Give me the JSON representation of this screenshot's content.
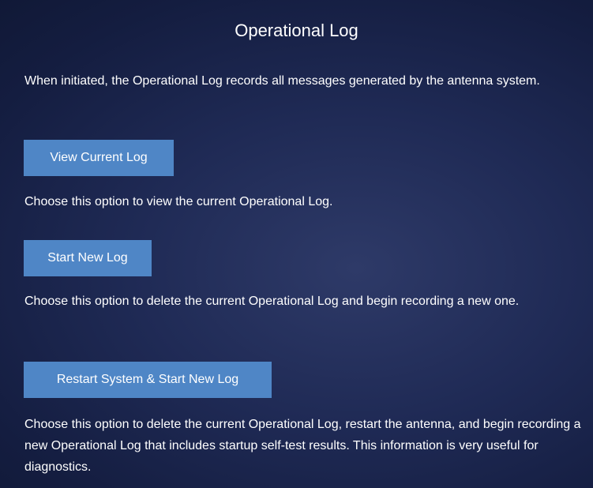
{
  "panel": {
    "title": "Operational Log",
    "intro": "When initiated, the Operational Log records all messages generated by the antenna system.",
    "actions": [
      {
        "button_label": "View Current Log",
        "description": "Choose this option to view the current Operational Log."
      },
      {
        "button_label": "Start New Log",
        "description": "Choose this option to delete the current Operational Log and begin recording a new one."
      },
      {
        "button_label": "Restart System & Start New Log",
        "description": "Choose this option to delete the current Operational Log, restart the antenna, and begin recording a new Operational Log that includes startup self-test results. This information is very useful for diagnostics."
      }
    ]
  },
  "colors": {
    "background": "#1f2a55",
    "button": "#4f86c6",
    "text": "#ffffff"
  }
}
